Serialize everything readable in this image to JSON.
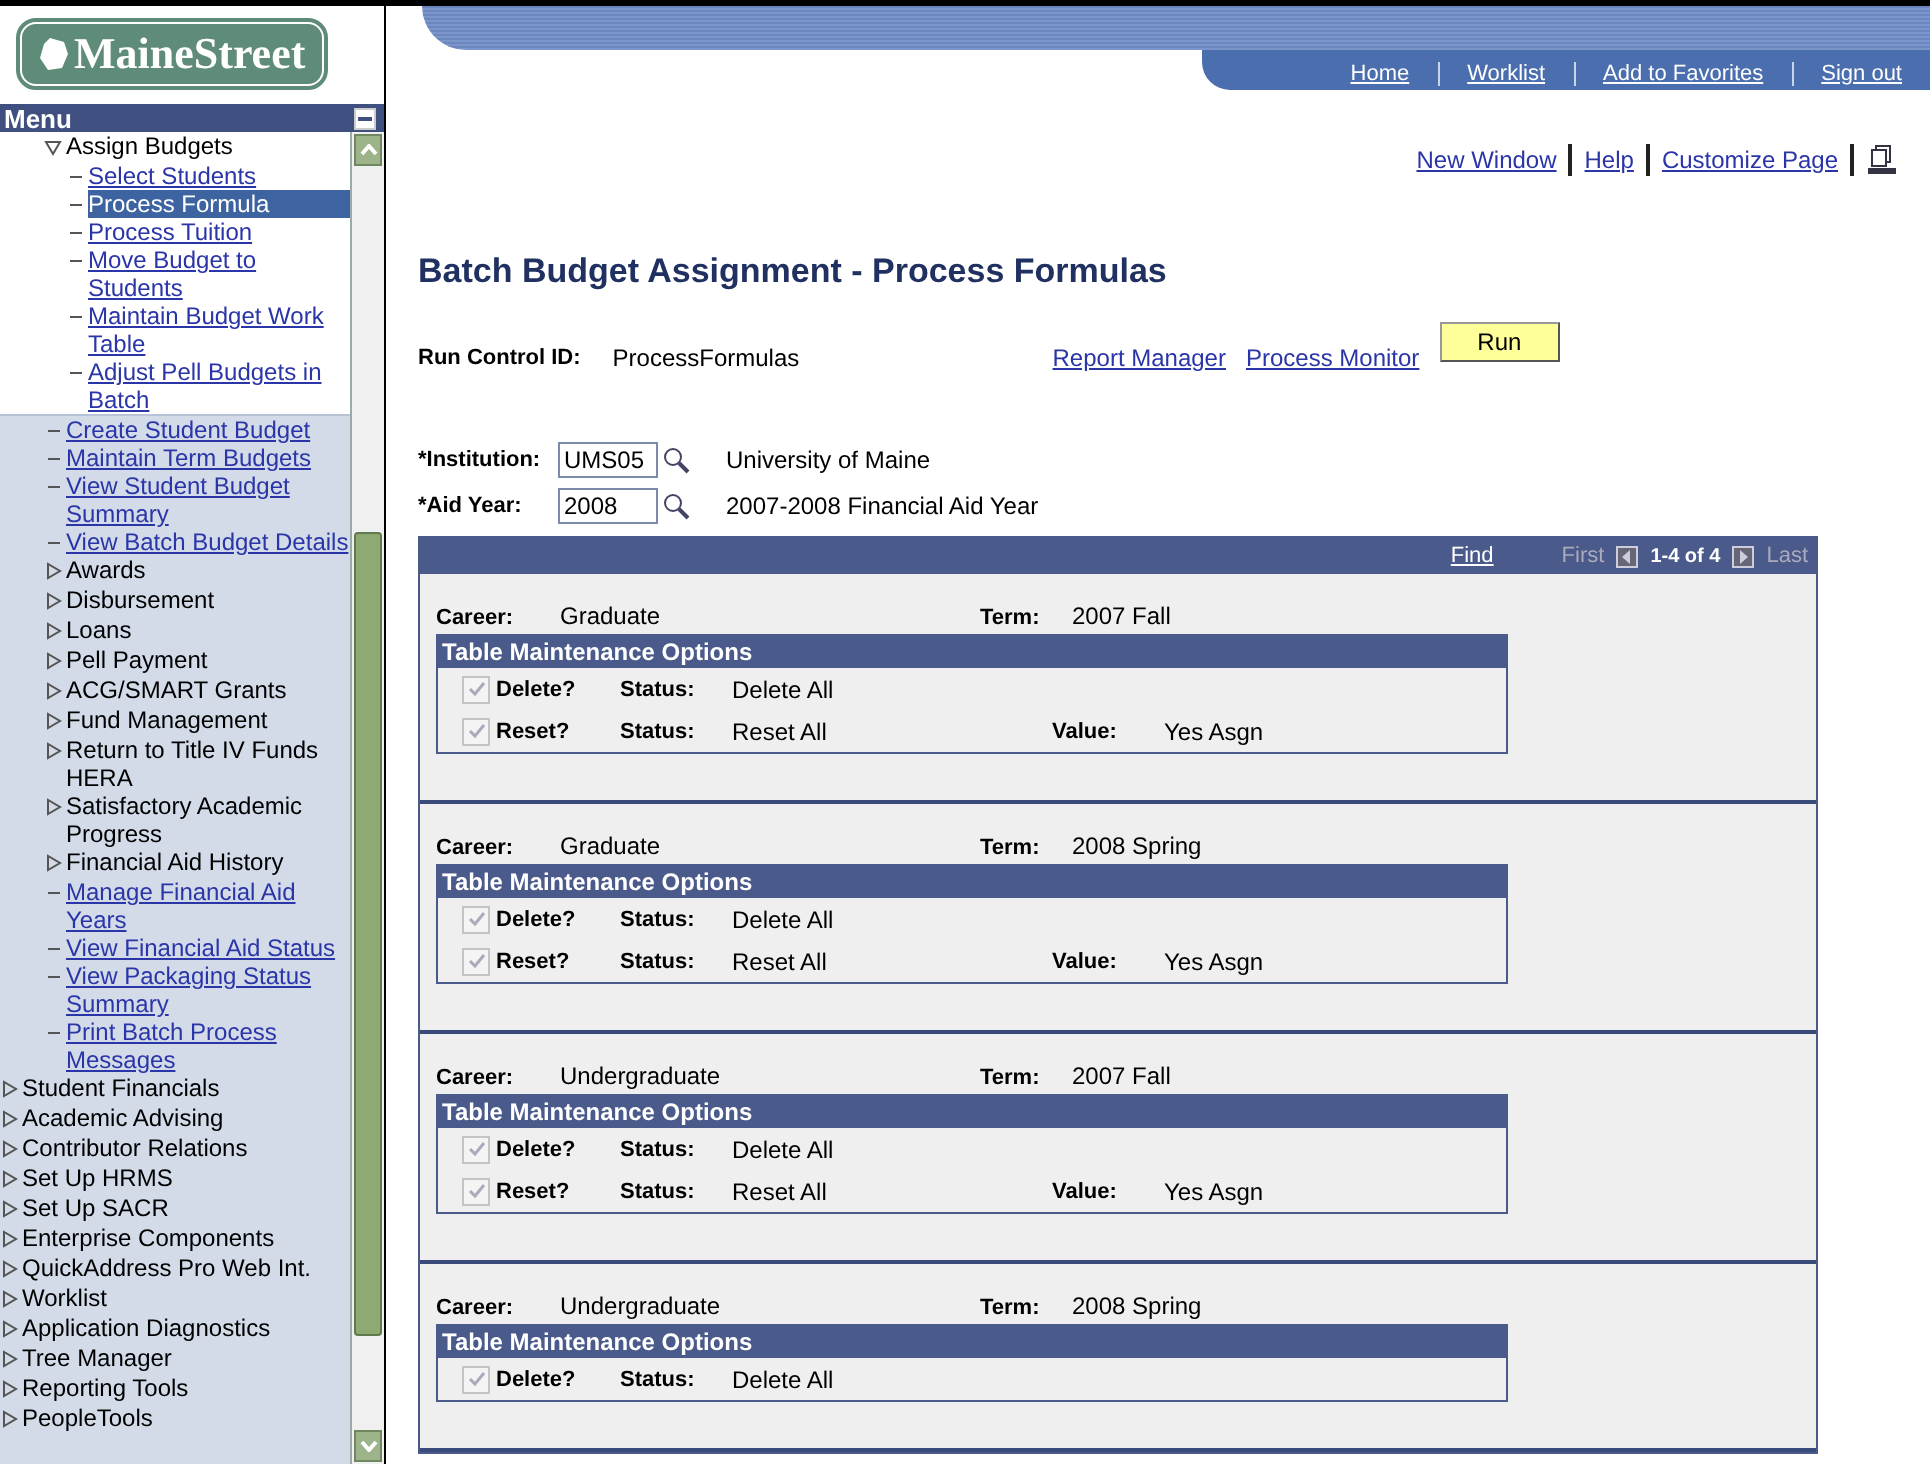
{
  "logo": {
    "text": "MaineStreet"
  },
  "nav": [
    "Home",
    "Worklist",
    "Add to Favorites",
    "Sign out"
  ],
  "menu": {
    "title": "Menu",
    "nested_items": [
      {
        "label": "Assign Budgets",
        "kind": "folder",
        "expanded": true,
        "children": [
          {
            "label": "Select Students",
            "kind": "link",
            "selected": false
          },
          {
            "label": "Process Formula",
            "kind": "link",
            "selected": true
          },
          {
            "label": "Process Tuition",
            "kind": "link",
            "selected": false
          },
          {
            "label": "Move Budget to Students",
            "kind": "link",
            "selected": false
          },
          {
            "label": "Maintain Budget Work Table",
            "kind": "link",
            "selected": false
          },
          {
            "label": "Adjust Pell Budgets in Batch",
            "kind": "link",
            "selected": false
          }
        ]
      },
      {
        "label": "Create Student Budget",
        "kind": "link",
        "selected": false
      },
      {
        "label": "Maintain Term Budgets",
        "kind": "link",
        "selected": false
      },
      {
        "label": "View Student Budget Summary",
        "kind": "link",
        "selected": false
      },
      {
        "label": "View Batch Budget Details",
        "kind": "link",
        "selected": false
      },
      {
        "label": "Awards",
        "kind": "folder",
        "expanded": false
      },
      {
        "label": "Disbursement",
        "kind": "folder",
        "expanded": false
      },
      {
        "label": "Loans",
        "kind": "folder",
        "expanded": false
      },
      {
        "label": "Pell Payment",
        "kind": "folder",
        "expanded": false
      },
      {
        "label": "ACG/SMART Grants",
        "kind": "folder",
        "expanded": false
      },
      {
        "label": "Fund Management",
        "kind": "folder",
        "expanded": false
      },
      {
        "label": "Return to Title IV Funds HERA",
        "kind": "folder",
        "expanded": false
      },
      {
        "label": "Satisfactory Academic Progress",
        "kind": "folder",
        "expanded": false
      },
      {
        "label": "Financial Aid History",
        "kind": "folder",
        "expanded": false
      },
      {
        "label": "Manage Financial Aid Years",
        "kind": "link",
        "selected": false
      },
      {
        "label": "View Financial Aid Status",
        "kind": "link",
        "selected": false
      },
      {
        "label": "View Packaging Status Summary",
        "kind": "link",
        "selected": false
      },
      {
        "label": "Print Batch Process Messages",
        "kind": "link",
        "selected": false
      }
    ],
    "items": [
      {
        "label": "Student Financials",
        "kind": "folder",
        "expanded": false
      },
      {
        "label": "Academic Advising",
        "kind": "folder",
        "expanded": false
      },
      {
        "label": "Contributor Relations",
        "kind": "folder",
        "expanded": false
      },
      {
        "label": "Set Up HRMS",
        "kind": "folder",
        "expanded": false
      },
      {
        "label": "Set Up SACR",
        "kind": "folder",
        "expanded": false
      },
      {
        "label": "Enterprise Components",
        "kind": "folder",
        "expanded": false
      },
      {
        "label": "QuickAddress Pro Web Int.",
        "kind": "folder",
        "expanded": false
      },
      {
        "label": "Worklist",
        "kind": "folder",
        "expanded": false
      },
      {
        "label": "Application Diagnostics",
        "kind": "folder",
        "expanded": false
      },
      {
        "label": "Tree Manager",
        "kind": "folder",
        "expanded": false
      },
      {
        "label": "Reporting Tools",
        "kind": "folder",
        "expanded": false
      },
      {
        "label": "PeopleTools",
        "kind": "folder",
        "expanded": false
      }
    ]
  },
  "page_links": [
    "New Window",
    "Help",
    "Customize Page"
  ],
  "title": "Batch Budget Assignment - Process Formulas",
  "run_control": {
    "label": "Run Control ID:",
    "value": "ProcessFormulas",
    "links": [
      "Report Manager",
      "Process Monitor"
    ],
    "button": "Run"
  },
  "fields": [
    {
      "label": "*Institution:",
      "value": "UMS05",
      "description": "University of Maine"
    },
    {
      "label": "*Aid Year:",
      "value": "2008",
      "description": "2007-2008 Financial Aid Year"
    }
  ],
  "grid": {
    "find": "Find",
    "first": "First",
    "range": "1-4 of 4",
    "last": "Last",
    "records": [
      {
        "career_label": "Career:",
        "career": "Graduate",
        "term_label": "Term:",
        "term": "2007 Fall",
        "options_title": "Table Maintenance Options",
        "options": [
          {
            "label": "Delete?",
            "checked": true,
            "disabled": true,
            "status_label": "Status:",
            "status": "Delete All"
          },
          {
            "label": "Reset?",
            "checked": true,
            "disabled": true,
            "status_label": "Status:",
            "status": "Reset All",
            "value_label": "Value:",
            "value": "Yes Asgn"
          }
        ]
      },
      {
        "career_label": "Career:",
        "career": "Graduate",
        "term_label": "Term:",
        "term": "2008 Spring",
        "options_title": "Table Maintenance Options",
        "options": [
          {
            "label": "Delete?",
            "checked": true,
            "disabled": true,
            "status_label": "Status:",
            "status": "Delete All"
          },
          {
            "label": "Reset?",
            "checked": true,
            "disabled": true,
            "status_label": "Status:",
            "status": "Reset All",
            "value_label": "Value:",
            "value": "Yes Asgn"
          }
        ]
      },
      {
        "career_label": "Career:",
        "career": "Undergraduate",
        "term_label": "Term:",
        "term": "2007 Fall",
        "options_title": "Table Maintenance Options",
        "options": [
          {
            "label": "Delete?",
            "checked": true,
            "disabled": true,
            "status_label": "Status:",
            "status": "Delete All"
          },
          {
            "label": "Reset?",
            "checked": true,
            "disabled": true,
            "status_label": "Status:",
            "status": "Reset All",
            "value_label": "Value:",
            "value": "Yes Asgn"
          }
        ]
      },
      {
        "career_label": "Career:",
        "career": "Undergraduate",
        "term_label": "Term:",
        "term": "2008 Spring",
        "options_title": "Table Maintenance Options",
        "options": [
          {
            "label": "Delete?",
            "checked": true,
            "disabled": true,
            "status_label": "Status:",
            "status": "Delete All"
          }
        ]
      }
    ]
  }
}
